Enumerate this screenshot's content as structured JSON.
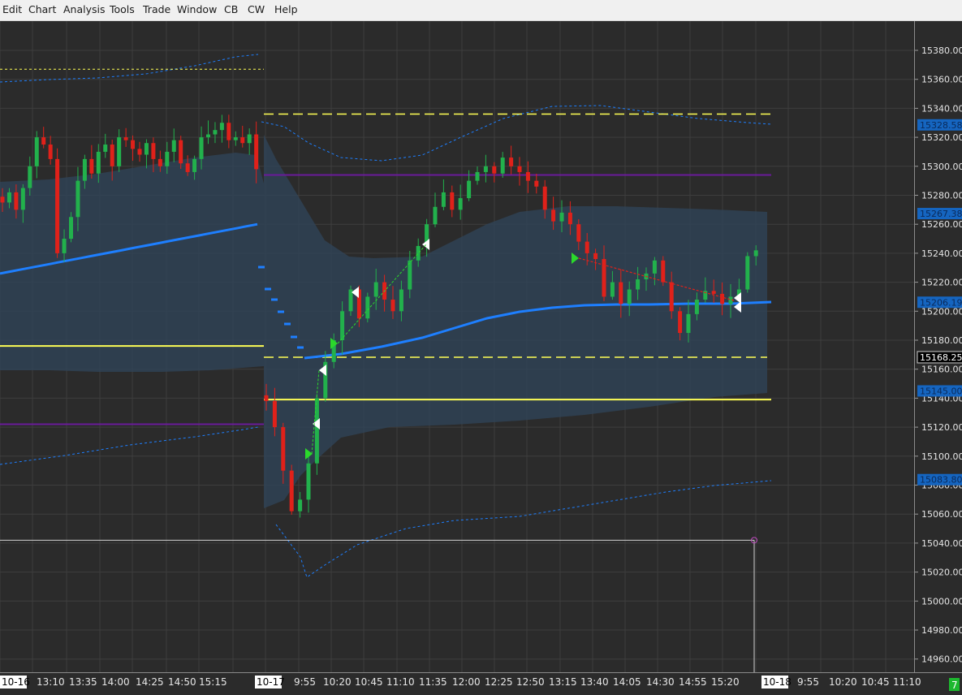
{
  "menu": [
    "Edit",
    "Chart",
    "Analysis",
    "Tools",
    "Trade",
    "Window",
    "CB",
    "CW",
    "Help"
  ],
  "colors": {
    "background": "#2b2b2b",
    "grid": "#3e3e3e",
    "up_candle": "#22b14c",
    "down_candle": "#e0211a",
    "vwap": "#1e7fff",
    "band_fill": "#2f4457",
    "yellow_level": "#ffff55",
    "purple_level": "#6a1b9a",
    "marker_buy": "#2bd92b",
    "marker_sell": "#ffffff",
    "tag_blue": "#1565c0",
    "tag_black": "#000000",
    "crosshair": "#d0d0d0",
    "status_green": "#1db82e"
  },
  "price_axis": {
    "min": 14950,
    "max": 15390,
    "step": 20,
    "labels": [
      "15380.00",
      "15360.00",
      "15340.00",
      "15320.00",
      "15300.00",
      "15280.00",
      "15260.00",
      "15240.00",
      "15220.00",
      "15200.00",
      "15180.00",
      "15160.00",
      "15140.00",
      "15120.00",
      "15100.00",
      "15080.00",
      "15060.00",
      "15040.00",
      "15020.00",
      "15000.00",
      "14980.00",
      "14960.00"
    ],
    "tags": [
      {
        "text": "15328.58",
        "price": 15328.58,
        "style": "blue"
      },
      {
        "text": "15267.38",
        "price": 15267.38,
        "style": "blue"
      },
      {
        "text": "15206.19",
        "price": 15206.19,
        "style": "blue"
      },
      {
        "text": "15168.25",
        "price": 15168.25,
        "style": "black"
      },
      {
        "text": "15145.00",
        "price": 15145.0,
        "style": "blue"
      },
      {
        "text": "15083.80",
        "price": 15083.8,
        "style": "blue"
      }
    ]
  },
  "time_axis": {
    "labels": [
      {
        "text": "10-16",
        "highlight": true
      },
      {
        "text": "13:10"
      },
      {
        "text": "13:35"
      },
      {
        "text": "14:00"
      },
      {
        "text": "14:25"
      },
      {
        "text": "14:50"
      },
      {
        "text": "15:15"
      },
      {
        "text": "10-17",
        "highlight": true
      },
      {
        "text": "9:55"
      },
      {
        "text": "10:20"
      },
      {
        "text": "10:45"
      },
      {
        "text": "11:10"
      },
      {
        "text": "11:35"
      },
      {
        "text": "12:00"
      },
      {
        "text": "12:25"
      },
      {
        "text": "12:50"
      },
      {
        "text": "13:15"
      },
      {
        "text": "13:40"
      },
      {
        "text": "14:05"
      },
      {
        "text": "14:30"
      },
      {
        "text": "14:55"
      },
      {
        "text": "15:20"
      },
      {
        "text": "10-18",
        "highlight": true
      },
      {
        "text": "9:55"
      },
      {
        "text": "10:20"
      },
      {
        "text": "10:45"
      },
      {
        "text": "11:10"
      }
    ],
    "status_badge": "7"
  },
  "chart_data": {
    "type": "candlestick",
    "instrument_sessions": [
      "10-16",
      "10-17",
      "10-18"
    ],
    "ylim": [
      14950,
      15390
    ],
    "crosshair": {
      "price": 15042,
      "time": "15:35"
    },
    "levels": [
      {
        "name": "yellow-solid",
        "price": 15176,
        "session": "10-16"
      },
      {
        "name": "yellow-solid",
        "price": 15139,
        "session": "10-17"
      },
      {
        "name": "yellow-dashed",
        "price": 15168.25,
        "session": "10-17"
      },
      {
        "name": "yellow-dashed",
        "price": 15336,
        "session": "10-17"
      },
      {
        "name": "yellow-dashed",
        "price": 15367,
        "session": "10-16"
      },
      {
        "name": "purple",
        "price": 15294,
        "session": "10-17"
      },
      {
        "name": "purple",
        "price": 15122,
        "session": "10-16"
      }
    ],
    "vwap_last": 15206.19,
    "day_high": 15313,
    "day_low": 15052,
    "closes_10_16": [
      15275,
      15282,
      15270,
      15285,
      15300,
      15320,
      15315,
      15305,
      15240,
      15250,
      15265,
      15290,
      15305,
      15295,
      15310,
      15315,
      15300,
      15320,
      15318,
      15312,
      15308,
      15316,
      15305,
      15300,
      15310,
      15318,
      15302,
      15296,
      15305,
      15320,
      15322,
      15325,
      15330,
      15318,
      15320,
      15316,
      15322,
      15298
    ],
    "closes_10_17": [
      15138,
      15120,
      15090,
      15062,
      15070,
      15095,
      15140,
      15165,
      15180,
      15200,
      15215,
      15195,
      15210,
      15220,
      15208,
      15200,
      15215,
      15235,
      15245,
      15260,
      15272,
      15282,
      15270,
      15278,
      15290,
      15296,
      15300,
      15295,
      15306,
      15300,
      15296,
      15290,
      15286,
      15270,
      15262,
      15268,
      15260,
      15248,
      15240,
      15236,
      15210,
      15220,
      15205,
      15215,
      15222,
      15226,
      15235,
      15220,
      15200,
      15185,
      15198,
      15208,
      15214,
      15212,
      15205,
      15210,
      15215,
      15238,
      15242
    ]
  }
}
